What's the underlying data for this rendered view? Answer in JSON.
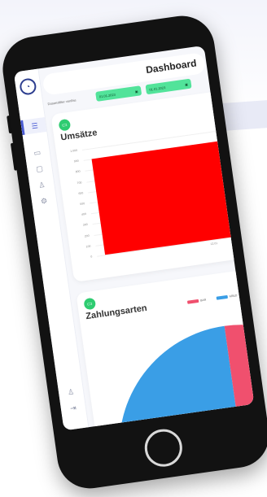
{
  "dashboard": {
    "title": "Dashboard",
    "filter_label": "Datumsfilter von/bis",
    "date_from": "01.01.2023",
    "date_to": "01.01.2023"
  },
  "colors": {
    "accent": "#52e39a",
    "bar": "#ff0000",
    "pie_blue": "#3a9ee6",
    "pie_pink": "#f0506e"
  },
  "sidebar": {
    "items": [
      {
        "icon": "menu-icon"
      },
      {
        "icon": "chart-icon"
      },
      {
        "icon": "folder-icon"
      },
      {
        "icon": "user-icon"
      },
      {
        "icon": "settings-icon"
      }
    ],
    "bottom": [
      {
        "icon": "profile-icon"
      },
      {
        "icon": "logout-icon"
      }
    ]
  },
  "cards": {
    "sales": {
      "title": "Umsätze"
    },
    "payments": {
      "title": "Zahlungsarten"
    }
  },
  "chart_data": [
    {
      "type": "bar",
      "title": "Umsätze",
      "categories": [
        "12.01"
      ],
      "values": [
        900
      ],
      "ylim": [
        0,
        1000
      ],
      "yticks": [
        "1.000",
        "900",
        "800",
        "700",
        "600",
        "500",
        "400",
        "300",
        "200",
        "100",
        "0"
      ],
      "grid": true
    },
    {
      "type": "pie",
      "title": "Zahlungsarten",
      "legend": [
        "BAR",
        "KRED"
      ]
    }
  ]
}
